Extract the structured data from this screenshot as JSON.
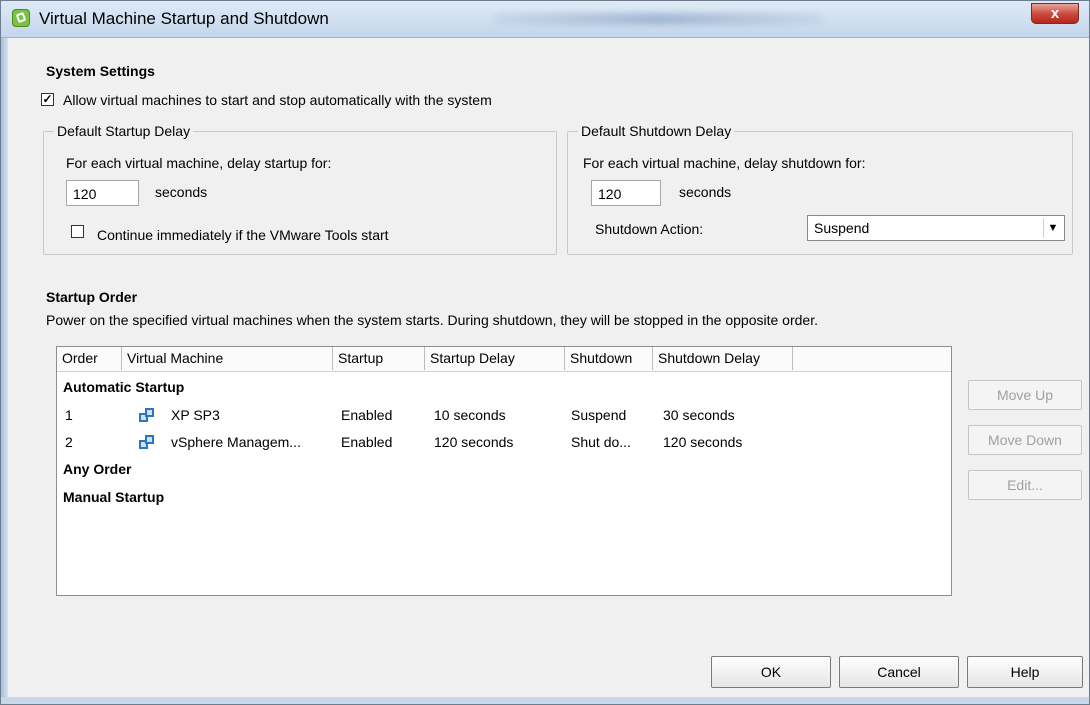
{
  "window": {
    "title": "Virtual Machine Startup and Shutdown",
    "close_glyph": "x"
  },
  "system_settings": {
    "heading": "System Settings",
    "allow_label": "Allow virtual machines to start and stop automatically with the system",
    "allow_checked": true
  },
  "startup_delay": {
    "legend": "Default Startup Delay",
    "description": "For each virtual machine, delay startup for:",
    "value": "120",
    "unit": "seconds",
    "continue_label": "Continue immediately if the VMware Tools start",
    "continue_checked": false
  },
  "shutdown_delay": {
    "legend": "Default Shutdown Delay",
    "description": "For each virtual machine, delay shutdown for:",
    "value": "120",
    "unit": "seconds",
    "action_label": "Shutdown Action:",
    "action_value": "Suspend"
  },
  "startup_order": {
    "heading": "Startup Order",
    "description": "Power on the specified virtual machines when the system starts. During shutdown, they will be stopped in the opposite order.",
    "columns": [
      "Order",
      "Virtual Machine",
      "Startup",
      "Startup Delay",
      "Shutdown",
      "Shutdown Delay"
    ],
    "groups": {
      "automatic": "Automatic Startup",
      "any": "Any Order",
      "manual": "Manual Startup"
    },
    "rows": [
      {
        "order": "1",
        "vm": "XP SP3",
        "startup": "Enabled",
        "startup_delay": "10 seconds",
        "shutdown": "Suspend",
        "shutdown_delay": "30 seconds"
      },
      {
        "order": "2",
        "vm": "vSphere Managem...",
        "startup": "Enabled",
        "startup_delay": "120 seconds",
        "shutdown": "Shut do...",
        "shutdown_delay": "120 seconds"
      }
    ]
  },
  "side_buttons": {
    "move_up": "Move Up",
    "move_down": "Move Down",
    "edit": "Edit..."
  },
  "footer": {
    "ok": "OK",
    "cancel": "Cancel",
    "help": "Help"
  },
  "colors": {
    "accent_icon": "#7cc242",
    "vm_icon": "#2d74c4",
    "close_button": "#c9473a"
  }
}
